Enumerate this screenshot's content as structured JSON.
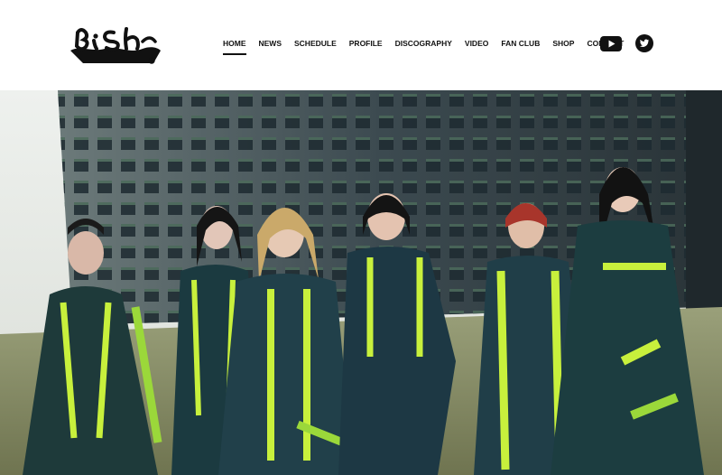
{
  "brand": {
    "logo_text": "BiSH",
    "registered_mark": "®"
  },
  "nav": {
    "items": [
      {
        "label": "HOME",
        "active": true
      },
      {
        "label": "NEWS",
        "active": false
      },
      {
        "label": "SCHEDULE",
        "active": false
      },
      {
        "label": "PROFILE",
        "active": false
      },
      {
        "label": "DISCOGRAPHY",
        "active": false
      },
      {
        "label": "VIDEO",
        "active": false
      },
      {
        "label": "FAN CLUB",
        "active": false
      },
      {
        "label": "SHOP",
        "active": false
      },
      {
        "label": "CONTACT",
        "active": false
      }
    ]
  },
  "social": {
    "youtube_icon": "youtube-icon",
    "twitter_icon": "twitter-icon"
  },
  "hero": {
    "image": "group-photo-six-members-ruined-building",
    "accent": "#c8f03c"
  }
}
